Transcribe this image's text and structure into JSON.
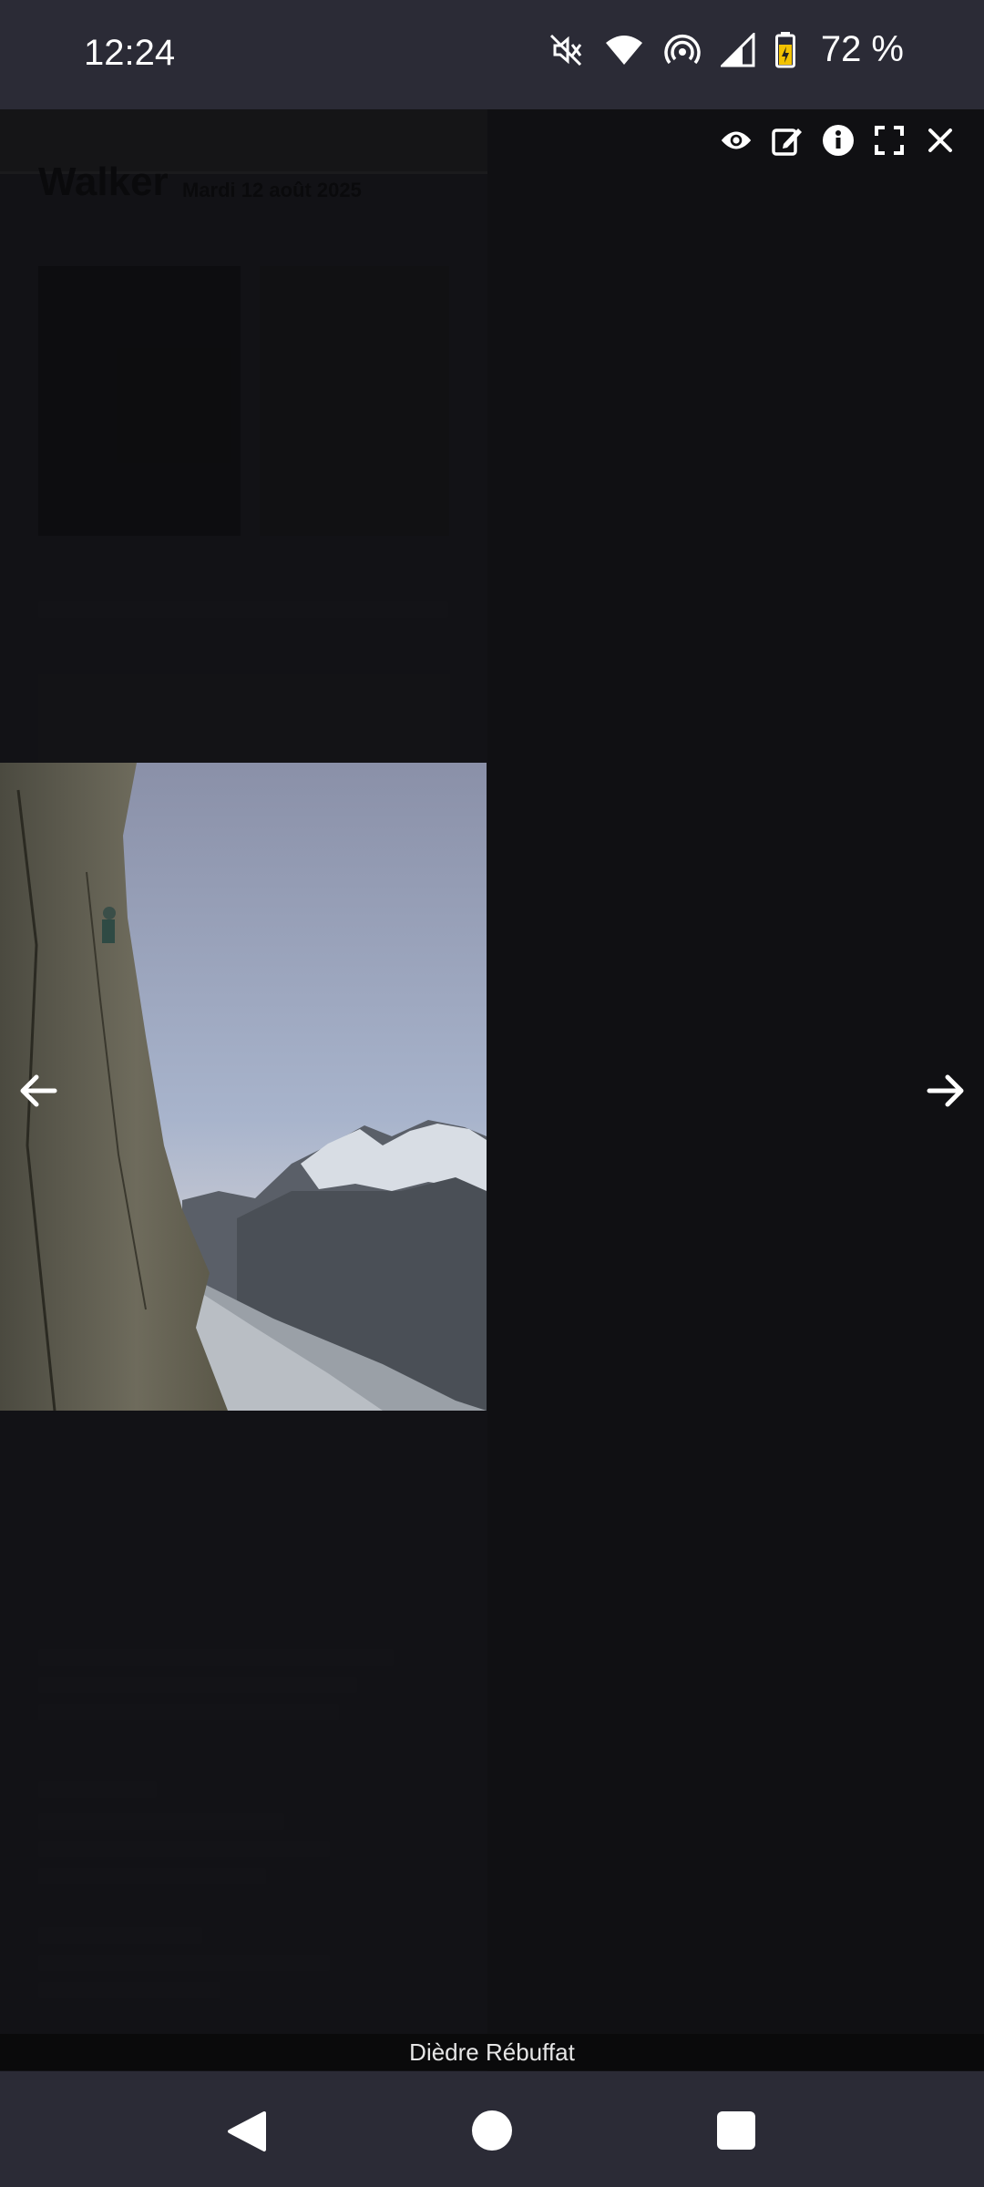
{
  "status_bar": {
    "time": "12:24",
    "battery": "72 %",
    "icons": [
      "mute-icon",
      "wifi-icon",
      "hotspot-icon",
      "signal-icon",
      "battery-icon"
    ]
  },
  "background_page": {
    "title": "Walker",
    "date": "Mardi 12 août 2025"
  },
  "toolbar": {
    "icons": [
      "eye-icon",
      "edit-icon",
      "info-icon",
      "fullscreen-icon",
      "close-icon"
    ]
  },
  "viewer": {
    "caption": "Dièdre Rébuffat",
    "prev_icon": "arrow-left-icon",
    "next_icon": "arrow-right-icon"
  },
  "nav_bar": {
    "icons": [
      "back-icon",
      "home-icon",
      "recents-icon"
    ]
  },
  "colors": {
    "status_bar_bg": "#2b2b36",
    "page_bg": "#17171a",
    "overlay": "#101012"
  }
}
